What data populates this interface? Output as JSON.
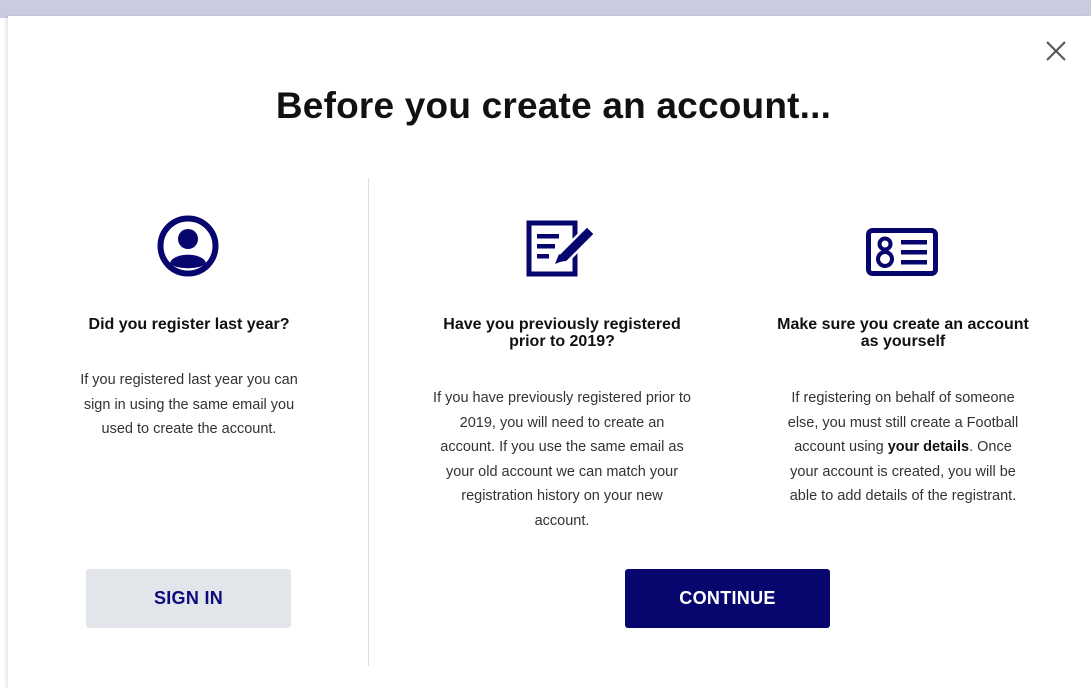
{
  "modal": {
    "title": "Before you create an account...",
    "close_label": "×"
  },
  "columns": [
    {
      "icon": "user-circle-icon",
      "heading": "Did you register last year?",
      "body_lines": [
        "If you registered last year you can",
        "sign in using the same email you",
        "used to create the account."
      ]
    },
    {
      "icon": "edit-form-icon",
      "heading_lines": [
        "Have you previously registered",
        "prior to 2019?"
      ],
      "body_lines": [
        "If you have previously registered prior to",
        "2019, you will need to create an",
        "account. If you use the same email as",
        "your old account we can match your",
        "registration history on your new",
        "account."
      ]
    },
    {
      "icon": "id-card-icon",
      "heading_lines": [
        "Make sure you create an account",
        "as yourself"
      ],
      "body_lines": [
        "If registering on behalf of someone",
        "else, you must still create a Football",
        "account using",
        "your details",
        ". Once",
        "your account is created, you will be",
        "able to add details of the registrant."
      ]
    }
  ],
  "buttons": {
    "sign_in": "SIGN IN",
    "continue": "CONTINUE"
  },
  "colors": {
    "brand_navy": "#07056e",
    "sign_in_bg": "#e2e5ea",
    "backdrop": "#c9cbe0"
  }
}
